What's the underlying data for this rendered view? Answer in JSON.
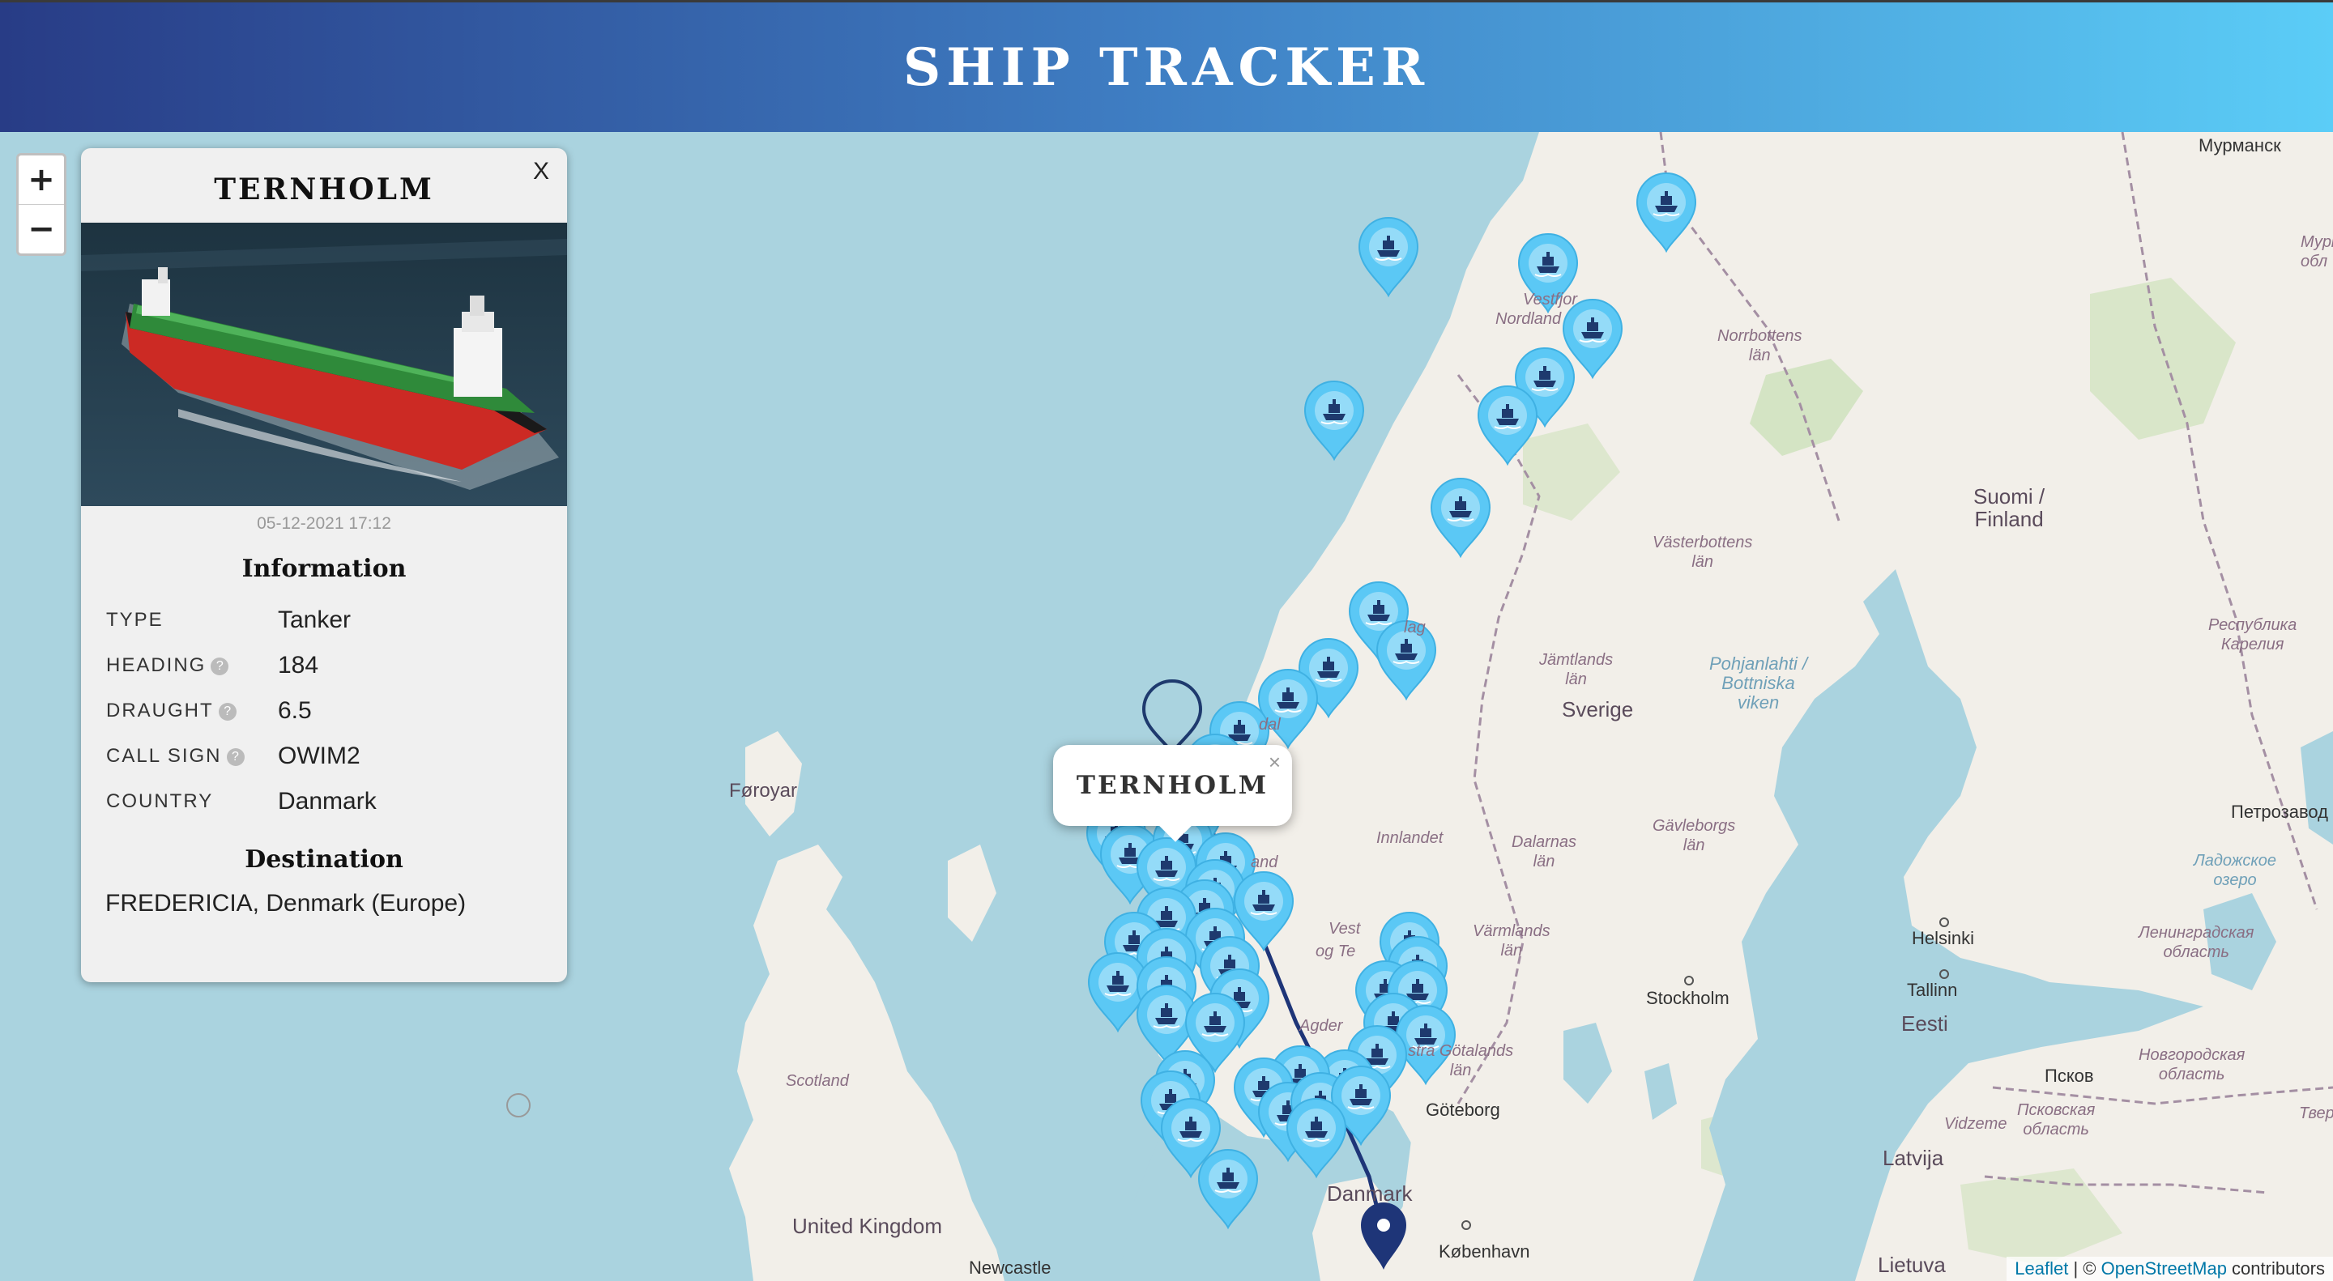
{
  "header": {
    "title": "SHIP TRACKER"
  },
  "map": {
    "zoom_in": "+",
    "zoom_out": "−",
    "attribution": {
      "leaflet": "Leaflet",
      "separator": " | © ",
      "osm": "OpenStreetMap",
      "suffix": " contributors"
    },
    "labels": {
      "murmansk": "Мурманск",
      "murm_obl": "Мурм",
      "obl": "обл",
      "vestfjord": "Vestfjor",
      "nordland": "Nordland",
      "norrbotten": "Norrbottens\nlän",
      "finland": "Suomi /\nFinland",
      "vasterbotten": "Västerbottens\nlän",
      "karelia": "Республика\nКарелия",
      "jamtland": "Jämtlands\nlän",
      "pohjanlahti": "Pohjanlahti /\nBottniska\nviken",
      "sverige": "Sverige",
      "faroe": "Føroyar",
      "gavleborg": "Gävleborgs\nlän",
      "petrozavodsk": "Петрозавод",
      "ladoga": "Ладожское\nозеро",
      "innlandet": "Innlandet",
      "dalarna": "Dalarnas\nlän",
      "helsinki": "Helsinki",
      "leningrad": "Ленинградская\nобласть",
      "tallinn": "Tallinn",
      "varmland": "Värmlands\nlän",
      "stockholm": "Stockholm",
      "eesti": "Eesti",
      "vest": "Vest",
      "og_te": "og Te",
      "agder": "Agder",
      "vgotaland": "stra Götalands\nlän",
      "novgorod": "Новгородская\nобласть",
      "scotland": "Scotland",
      "goteborg": "Göteborg",
      "pskov": "Псков",
      "vidzeme": "Vidzeme",
      "pskov_obl": "Псковская\nобласть",
      "latvija": "Latvija",
      "danmark": "Danmark",
      "uk": "United Kingdom",
      "kobenhavn": "København",
      "newcastle": "Newcastle",
      "lietuva": "Lietuva",
      "dal": "dal",
      "lag": "lag",
      "and": "and",
      "tver": "Тверс"
    }
  },
  "panel": {
    "close": "X",
    "ship_name": "TERNHOLM",
    "timestamp": "05-12-2021 17:12",
    "info_heading": "Information",
    "rows": [
      {
        "key": "TYPE",
        "value": "Tanker",
        "help": false
      },
      {
        "key": "HEADING",
        "value": "184",
        "help": true
      },
      {
        "key": "DRAUGHT",
        "value": "6.5",
        "help": true
      },
      {
        "key": "CALL SIGN",
        "value": "OWIM2",
        "help": true
      },
      {
        "key": "COUNTRY",
        "value": "Danmark",
        "help": false
      }
    ],
    "help_glyph": "?",
    "destination_heading": "Destination",
    "destination": "FREDERICIA, Denmark (Europe)"
  },
  "popup": {
    "name": "TERNHOLM",
    "close": "×"
  },
  "colors": {
    "marker": "#5bc8f5",
    "selected_marker": "#1e3578",
    "route": "#1e3578",
    "sea": "#aad3df",
    "land": "#f2efe9"
  }
}
